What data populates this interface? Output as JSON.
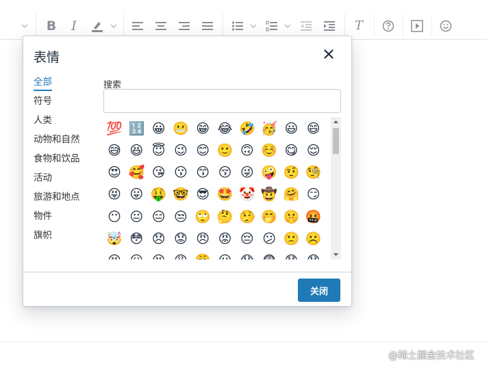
{
  "dialog": {
    "title": "表情",
    "close_icon": "close-icon",
    "categories": [
      {
        "label": "全部",
        "active": true
      },
      {
        "label": "符号",
        "active": false
      },
      {
        "label": "人类",
        "active": false
      },
      {
        "label": "动物和自然",
        "active": false
      },
      {
        "label": "食物和饮品",
        "active": false
      },
      {
        "label": "活动",
        "active": false
      },
      {
        "label": "旅游和地点",
        "active": false
      },
      {
        "label": "物件",
        "active": false
      },
      {
        "label": "旗帜",
        "active": false
      }
    ],
    "search": {
      "label": "搜索",
      "value": "",
      "placeholder": ""
    },
    "emojis": [
      "💯",
      "🔢",
      "😀",
      "😬",
      "😁",
      "😂",
      "🤣",
      "🥳",
      "😃",
      "😄",
      "😅",
      "😆",
      "😇",
      "😉",
      "😊",
      "🙂",
      "🙃",
      "☺️",
      "😋",
      "😌",
      "😍",
      "🥰",
      "😘",
      "😗",
      "😙",
      "😚",
      "😜",
      "🤪",
      "🤨",
      "🧐",
      "😝",
      "😛",
      "🤑",
      "🤓",
      "😎",
      "🤩",
      "🤡",
      "🤠",
      "🤗",
      "😏",
      "😶",
      "😐",
      "😑",
      "😒",
      "🙄",
      "🤔",
      "🤥",
      "🤭",
      "🤫",
      "🤬",
      "🤯",
      "😳",
      "😞",
      "😟",
      "😠",
      "😡",
      "😔",
      "😕",
      "🙁",
      "☹️",
      "😣",
      "😖",
      "😫",
      "😩",
      "😤",
      "😮",
      "😱",
      "😨",
      "😰",
      "😯"
    ],
    "footer": {
      "close_label": "关闭"
    }
  },
  "toolbar": {
    "icons": [
      "bold-icon",
      "italic-icon",
      "highlight-icon",
      "align-left-icon",
      "align-center-icon",
      "align-right-icon",
      "align-justify-icon",
      "bullet-list-icon",
      "numbered-list-icon",
      "outdent-icon",
      "indent-icon",
      "clear-format-icon",
      "help-icon",
      "media-icon",
      "emoticons-icon"
    ],
    "bold_glyph": "B",
    "italic_glyph": "I",
    "clear_glyph": "T"
  },
  "watermark": "@稀土掘金技术社区"
}
